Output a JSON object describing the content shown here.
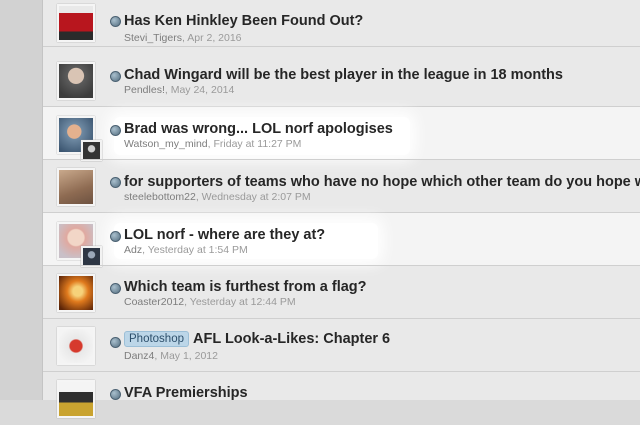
{
  "threads": [
    {
      "title": "Has Ken Hinkley Been Found Out?",
      "author": "Stevi_Tigers",
      "date": "Apr 2, 2016"
    },
    {
      "title": "Chad Wingard will be the best player in the league in 18 months",
      "author": "Pendles!",
      "date": "May 24, 2014"
    },
    {
      "title": "Brad was wrong... LOL norf apologises",
      "author": "Watson_my_mind",
      "date": "Friday at 11:27 PM"
    },
    {
      "title": "for supporters of teams who have no hope which other team do you hope w",
      "author": "steelebottom22",
      "date": "Wednesday at 2:07 PM"
    },
    {
      "title": "LOL norf - where are they at?",
      "author": "Adz",
      "date": "Yesterday at 1:54 PM"
    },
    {
      "title": "Which team is furthest from a flag?",
      "author": "Coaster2012",
      "date": "Yesterday at 12:44 PM"
    },
    {
      "title": "AFL Look-a-Likes: Chapter 6",
      "prefix": "Photoshop",
      "author": "Danz4",
      "date": "May 1, 2012"
    },
    {
      "title": "VFA Premierships",
      "author": "",
      "date": ""
    }
  ],
  "separator": ", ",
  "colors": {
    "title": "#262626",
    "meta": "#9a9a9a",
    "prefix_bg": "#bcd6e8",
    "highlight": "#ffffff"
  }
}
